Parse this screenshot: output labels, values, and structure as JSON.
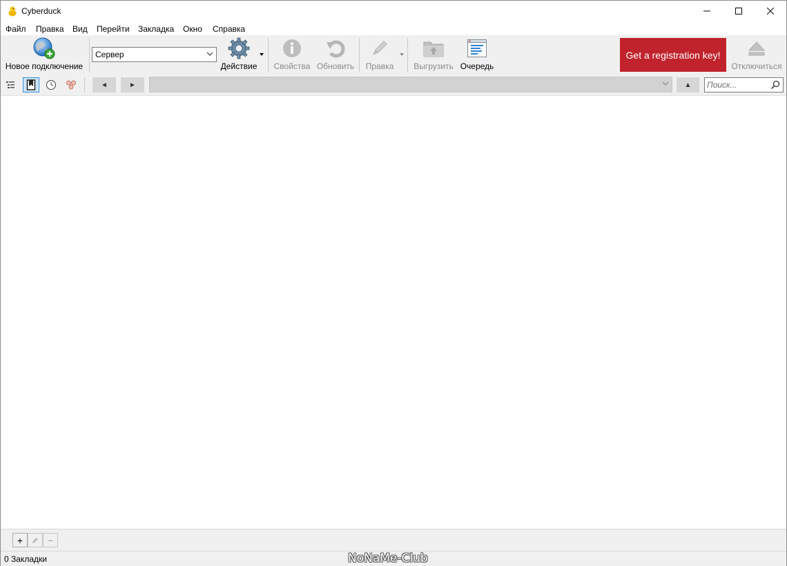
{
  "window": {
    "title": "Cyberduck"
  },
  "menu": [
    "Файл",
    "Правка",
    "Вид",
    "Перейти",
    "Закладка",
    "Окно",
    "Справка"
  ],
  "toolbar": {
    "new_connection": "Новое подключение",
    "server_value": "Сервер",
    "action": "Действие",
    "properties": "Свойства",
    "refresh": "Обновить",
    "edit": "Правка",
    "upload": "Выгрузить",
    "queue": "Очередь",
    "registration": "Get a registration key!",
    "disconnect": "Отключиться"
  },
  "navbar": {
    "back_icon": "◄",
    "forward_icon": "►",
    "up_icon": "▲",
    "search_placeholder": "Поиск..."
  },
  "bottombar": {
    "add": "+",
    "remove": "−"
  },
  "status": {
    "text": "0 Закладки",
    "watermark": "NoNaMe-Club"
  },
  "colors": {
    "registration_bg": "#c0232c",
    "toolbar_bg": "#f0f0f0",
    "active_view": "#cce4f7"
  }
}
